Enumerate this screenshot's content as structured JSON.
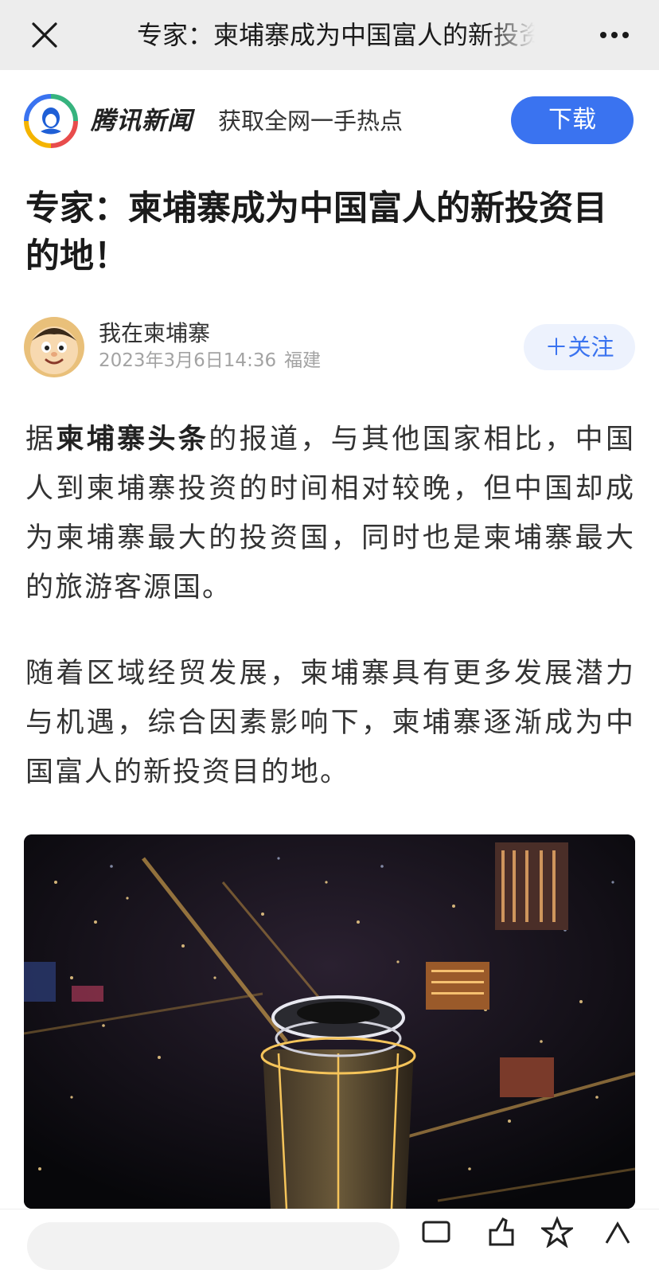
{
  "nav": {
    "title": "专家：柬埔寨成为中国富人的新投资目的地！"
  },
  "app_banner": {
    "brand": "腾讯新闻",
    "slogan": "获取全网一手热点",
    "download_label": "下载"
  },
  "article": {
    "headline": "专家：柬埔寨成为中国富人的新投资目的地！",
    "author": {
      "name": "我在柬埔寨",
      "date": "2023年3月6日14:36",
      "location": "福建",
      "follow_label": "＋关注"
    },
    "paragraph1": {
      "before": "据",
      "bold": "柬埔寨头条",
      "after": "的报道，与其他国家相比，中国人到柬埔寨投资的时间相对较晚，但中国却成为柬埔寨最大的投资国，同时也是柬埔寨最大的旅游客源国。"
    },
    "paragraph2": "随着区域经贸发展，柬埔寨具有更多发展潜力与机遇，综合因素影响下，柬埔寨逐渐成为中国富人的新投资目的地。"
  },
  "icons": {
    "close": "close-icon",
    "more": "more-icon",
    "logo": "tencent-news-logo",
    "avatar": "cartoon-avatar",
    "comment": "comment-icon",
    "like": "like-icon",
    "share": "share-icon"
  },
  "colors": {
    "accent": "#3a73f0",
    "follow_bg": "#edf2fd",
    "nav_bg": "#ededed"
  }
}
